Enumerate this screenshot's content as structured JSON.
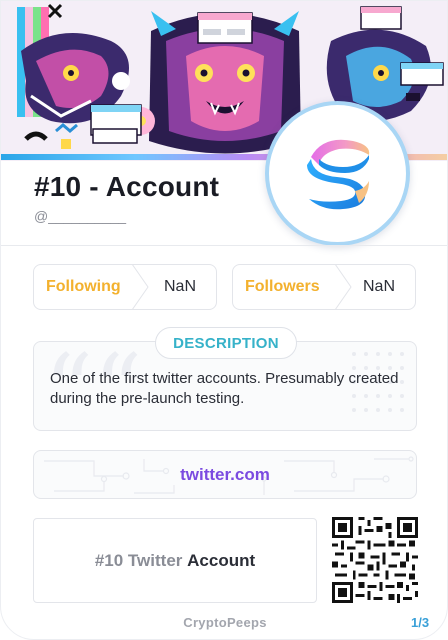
{
  "profile": {
    "title": "#10 - Account",
    "handle": "@__________"
  },
  "stats": {
    "following_label": "Following",
    "following_value": "NaN",
    "followers_label": "Followers",
    "followers_value": "NaN"
  },
  "description": {
    "heading": "DESCRIPTION",
    "text": "One of the first twitter accounts. Presumably created during the pre-launch testing."
  },
  "link": {
    "text": "twitter.com"
  },
  "name_card": {
    "prefix": "#10 Twitter",
    "suffix": "Account"
  },
  "footer": {
    "brand": "CryptoPeeps",
    "page": "1/3"
  },
  "icons": {
    "avatar": "twitter-s-logo-icon",
    "qr": "qr-code-icon",
    "banner": "tiger-dragon-artwork"
  },
  "colors": {
    "accent_yellow": "#f3b12e",
    "accent_teal": "#36b2c9",
    "link_purple": "#7b4be0",
    "page_blue": "#3aa0d8"
  }
}
